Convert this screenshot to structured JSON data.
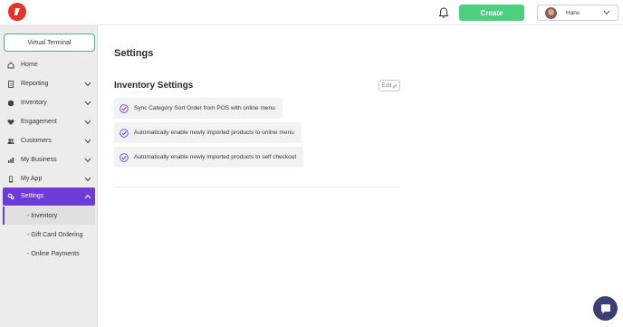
{
  "header": {
    "create_label": "Create",
    "user_name": "Hans"
  },
  "sidebar": {
    "virtual_terminal": "Virtual Terminal",
    "items": [
      {
        "label": "Home",
        "icon": "home-icon"
      },
      {
        "label": "Reporting",
        "icon": "report-icon"
      },
      {
        "label": "Inventory",
        "icon": "inventory-icon"
      },
      {
        "label": "Engagement",
        "icon": "heart-icon"
      },
      {
        "label": "Customers",
        "icon": "customers-icon"
      },
      {
        "label": "My Business",
        "icon": "chart-icon"
      },
      {
        "label": "My App",
        "icon": "phone-icon"
      },
      {
        "label": "Settings",
        "icon": "settings-icon"
      }
    ],
    "sub_items": [
      {
        "label": "- Inventory"
      },
      {
        "label": "- Gift Card Ordering"
      },
      {
        "label": "- Online Payments"
      }
    ]
  },
  "main": {
    "page_title": "Settings",
    "section_title": "Inventory Settings",
    "edit_label": "Edit",
    "settings": [
      {
        "label": "Sync Category Sort Order from POS with online menu"
      },
      {
        "label": "Automatically enable newly imported products to online menu"
      },
      {
        "label": "Automatically enable newly imported products to self checkout"
      }
    ]
  },
  "colors": {
    "accent": "#6d3bd6",
    "create_button": "#4cd080",
    "logo_red": "#e5332a",
    "chat_button": "#3b3f73"
  }
}
